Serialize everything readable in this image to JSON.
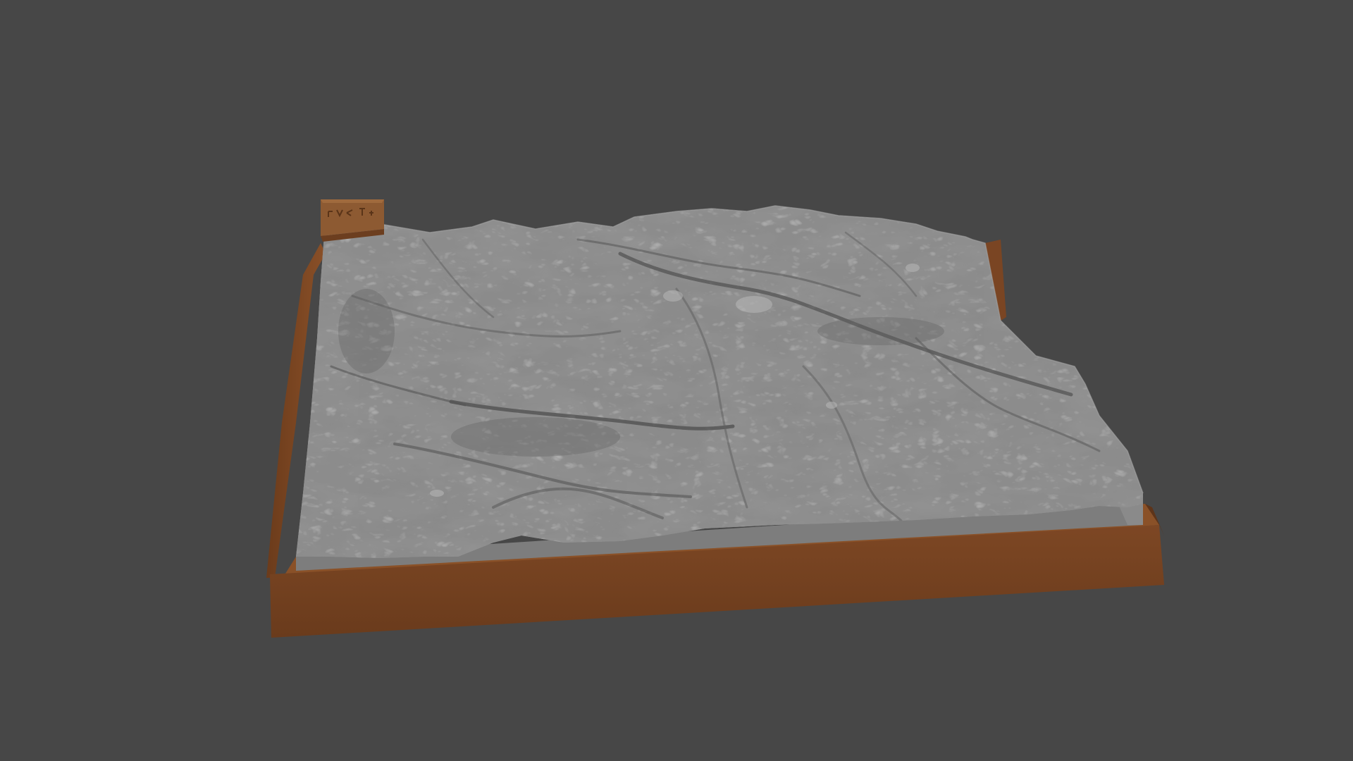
{
  "scene": {
    "subject": "3d-printed-terrain-relief-model",
    "colors": {
      "background": "#474747",
      "terrain_top": "#8c8c8c",
      "terrain_shadow": "#5e5e5e",
      "terrain_side": "#7a7a7a",
      "base_brown": "#7a4523",
      "base_brown_dark": "#5e3419",
      "base_brown_light": "#8a5128",
      "label_block": "#8d5a32"
    },
    "icons": [
      "terrain-model",
      "wooden-base",
      "label-block"
    ],
    "label_block_marking": "map-legend-glyphs"
  }
}
